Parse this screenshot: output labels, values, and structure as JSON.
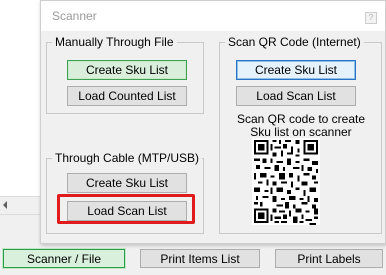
{
  "background_app": {
    "bottom_buttons": {
      "scanner_file": "Scanner / File",
      "print_items_list": "Print Items List",
      "print_labels": "Print Labels"
    }
  },
  "dialog": {
    "title": "Scanner",
    "close_label": "?",
    "manual_file": {
      "label": "Manually Through File",
      "create_sku_list": "Create Sku List",
      "load_counted_list": "Load Counted List"
    },
    "qr_internet": {
      "label": "Scan QR Code (Internet)",
      "create_sku_list": "Create Sku List",
      "load_scan_list": "Load Scan List",
      "caption_line1": "Scan QR code to create",
      "caption_line2": "Sku list on scanner"
    },
    "cable": {
      "label": "Through Cable (MTP/USB)",
      "create_sku_list": "Create Sku List",
      "load_scan_list": "Load Scan List"
    }
  },
  "colors": {
    "highlight": "#e01b1b",
    "focus_green": "#3fa14f",
    "focus_blue": "#2a72c4"
  }
}
